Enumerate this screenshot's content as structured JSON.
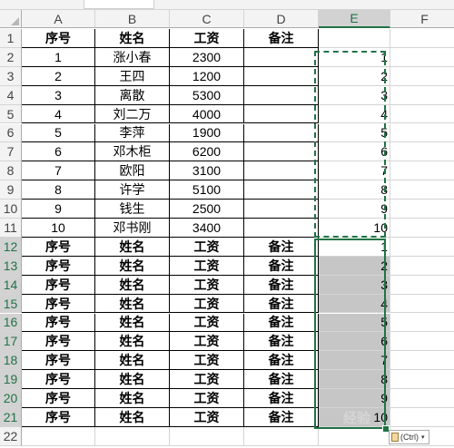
{
  "columns": [
    "A",
    "B",
    "C",
    "D",
    "E",
    "F"
  ],
  "rows": [
    "1",
    "2",
    "3",
    "4",
    "5",
    "6",
    "7",
    "8",
    "9",
    "10",
    "11",
    "12",
    "13",
    "14",
    "15",
    "16",
    "17",
    "18",
    "19",
    "20",
    "21",
    "22"
  ],
  "header": [
    "序号",
    "姓名",
    "工资",
    "备注"
  ],
  "records": [
    {
      "seq": "1",
      "name": "涨小春",
      "salary": "2300",
      "e": "1"
    },
    {
      "seq": "2",
      "name": "王四",
      "salary": "1200",
      "e": "2"
    },
    {
      "seq": "3",
      "name": "离散",
      "salary": "5300",
      "e": "3"
    },
    {
      "seq": "4",
      "name": "刘二万",
      "salary": "4000",
      "e": "4"
    },
    {
      "seq": "5",
      "name": "李萍",
      "salary": "1900",
      "e": "5"
    },
    {
      "seq": "6",
      "name": "邓木柜",
      "salary": "6200",
      "e": "6"
    },
    {
      "seq": "7",
      "name": "欧阳",
      "salary": "3100",
      "e": "7"
    },
    {
      "seq": "8",
      "name": "许学",
      "salary": "5100",
      "e": "8"
    },
    {
      "seq": "9",
      "name": "钱生",
      "salary": "2500",
      "e": "9"
    },
    {
      "seq": "10",
      "name": "邓书刚",
      "salary": "3400",
      "e": "10"
    }
  ],
  "pasted_e_values": [
    "1",
    "2",
    "3",
    "4",
    "5",
    "6",
    "7",
    "8",
    "9",
    "10"
  ],
  "paste_options_label": "(Ctrl)",
  "watermark_text": "经验",
  "colors": {
    "accent": "#217346",
    "selection_fill": "#c6c6c6",
    "header_bg": "#f3f3f3",
    "gridline": "#d4d4d4"
  },
  "icons": [
    "clipboard-icon",
    "dropdown-arrow-icon",
    "select-all-triangle-icon"
  ]
}
